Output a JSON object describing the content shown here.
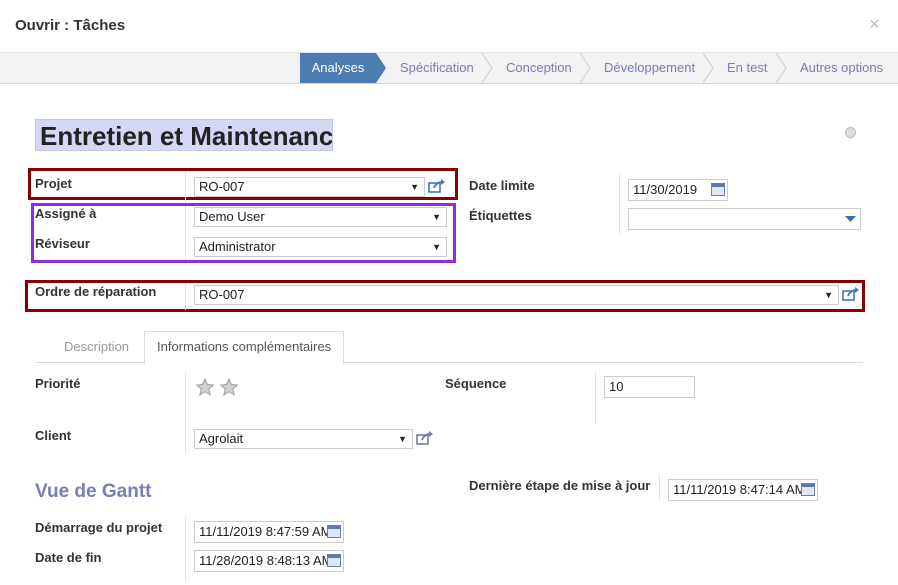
{
  "dialog": {
    "title": "Ouvrir : Tâches",
    "close": "×"
  },
  "stages": [
    "Analyses",
    "Spécification",
    "Conception",
    "Développement",
    "En test",
    "Autres options"
  ],
  "task": {
    "name": "Entretien et Maintenanc",
    "project_label": "Projet",
    "project_value": "RO-007",
    "assigned_label": "Assigné à",
    "assigned_value": "Demo User",
    "reviewer_label": "Réviseur",
    "reviewer_value": "Administrator",
    "deadline_label": "Date limite",
    "deadline_value": "11/30/2019",
    "tags_label": "Étiquettes",
    "tags_value": "",
    "repair_label": "Ordre de réparation",
    "repair_value": "RO-007"
  },
  "tabs": [
    "Description",
    "Informations complémentaires"
  ],
  "info": {
    "priority_label": "Priorité",
    "priority_stars": 0,
    "sequence_label": "Séquence",
    "sequence_value": "10",
    "client_label": "Client",
    "client_value": "Agrolait"
  },
  "gantt": {
    "title": "Vue de Gantt",
    "last_stage_label": "Dernière étape de mise à jour",
    "last_stage_value": "11/11/2019 8:47:14 AM",
    "start_label": "Démarrage du projet",
    "start_value": "11/11/2019 8:47:59 AM",
    "end_label": "Date de fin",
    "end_value": "11/28/2019 8:48:13 AM"
  },
  "colors": {
    "active_stage": "#4d7cb3",
    "stage_text": "#7a7fb0",
    "highlight_red": "#8b0000",
    "highlight_purple": "#8f2be6"
  }
}
